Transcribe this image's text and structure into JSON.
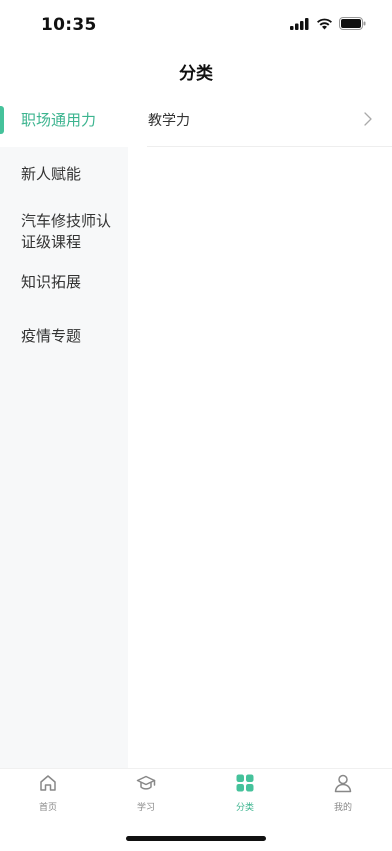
{
  "status": {
    "time": "10:35"
  },
  "header": {
    "title": "分类"
  },
  "sidebar": {
    "items": [
      {
        "label": "职场通用力",
        "active": true
      },
      {
        "label": "新人赋能",
        "active": false
      },
      {
        "label": "汽车修技师认证级课程",
        "active": false
      },
      {
        "label": "知识拓展",
        "active": false
      },
      {
        "label": "疫情专题",
        "active": false
      }
    ]
  },
  "content": {
    "items": [
      {
        "label": "教学力"
      }
    ]
  },
  "tabbar": {
    "items": [
      {
        "label": "首页",
        "icon": "home-icon"
      },
      {
        "label": "学习",
        "icon": "graduation-cap-icon"
      },
      {
        "label": "分类",
        "icon": "grid-icon",
        "active": true
      },
      {
        "label": "我的",
        "icon": "user-icon"
      }
    ]
  },
  "colors": {
    "accent": "#3cb48f",
    "sidebar_bg": "#f7f8f9",
    "inactive": "#888888"
  }
}
